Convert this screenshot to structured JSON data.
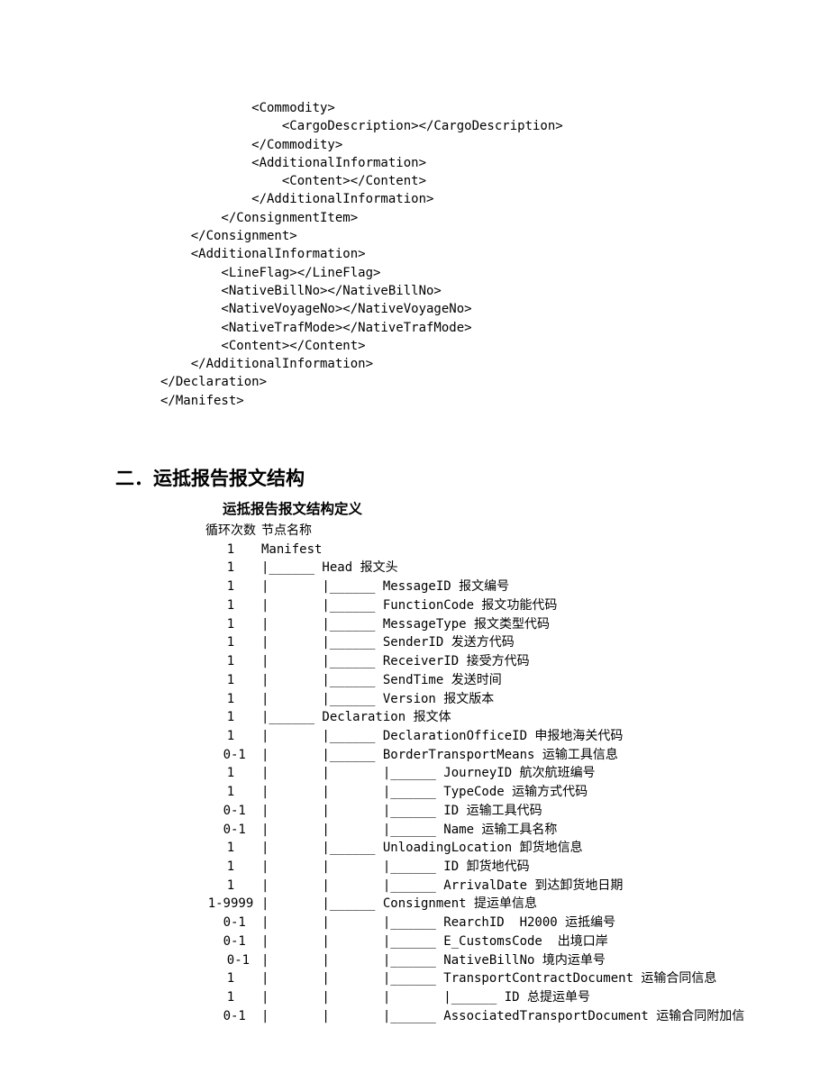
{
  "xml_lines": [
    "            <Commodity>",
    "                <CargoDescription></CargoDescription>",
    "            </Commodity>",
    "            <AdditionalInformation>",
    "                <Content></Content>",
    "            </AdditionalInformation>",
    "        </ConsignmentItem>",
    "    </Consignment>",
    "    <AdditionalInformation>",
    "        <LineFlag></LineFlag>",
    "        <NativeBillNo></NativeBillNo>",
    "        <NativeVoyageNo></NativeVoyageNo>",
    "        <NativeTrafMode></NativeTrafMode>",
    "        <Content></Content>",
    "    </AdditionalInformation>",
    "</Declaration>",
    "</Manifest>"
  ],
  "section_heading": "二．运抵报告报文结构",
  "sub_heading": "运抵报告报文结构定义",
  "tree_header": {
    "count": "循环次数",
    "node": "节点名称"
  },
  "tree_rows": [
    {
      "count": "1",
      "node": "Manifest"
    },
    {
      "count": "1",
      "node": "|______ Head 报文头"
    },
    {
      "count": "1",
      "node": "|       |______ MessageID 报文编号"
    },
    {
      "count": "1",
      "node": "|       |______ FunctionCode 报文功能代码"
    },
    {
      "count": "1",
      "node": "|       |______ MessageType 报文类型代码"
    },
    {
      "count": "1",
      "node": "|       |______ SenderID 发送方代码"
    },
    {
      "count": "1",
      "node": "|       |______ ReceiverID 接受方代码"
    },
    {
      "count": "1",
      "node": "|       |______ SendTime 发送时间"
    },
    {
      "count": "1",
      "node": "|       |______ Version 报文版本"
    },
    {
      "count": "1",
      "node": "|______ Declaration 报文体"
    },
    {
      "count": "1",
      "node": "|       |______ DeclarationOfficeID 申报地海关代码"
    },
    {
      "count": " 0-1",
      "node": "|       |______ BorderTransportMeans 运输工具信息"
    },
    {
      "count": "1",
      "node": "|       |       |______ JourneyID 航次航班编号"
    },
    {
      "count": "1",
      "node": "|       |       |______ TypeCode 运输方式代码"
    },
    {
      "count": " 0-1",
      "node": "|       |       |______ ID 运输工具代码"
    },
    {
      "count": " 0-1",
      "node": "|       |       |______ Name 运输工具名称"
    },
    {
      "count": "1",
      "node": "|       |______ UnloadingLocation 卸货地信息"
    },
    {
      "count": "1",
      "node": "|       |       |______ ID 卸货地代码"
    },
    {
      "count": "1",
      "node": "|       |       |______ ArrivalDate 到达卸货地日期"
    },
    {
      "count": "1-9999",
      "node": "|       |______ Consignment 提运单信息"
    },
    {
      "count": " 0-1",
      "node": "|       |       |______ RearchID  H2000 运抵编号"
    },
    {
      "count": " 0-1",
      "node": "|       |       |______ E_CustomsCode  出境口岸"
    },
    {
      "count": "  0-1",
      "node": "|       |       |______ NativeBillNo 境内运单号"
    },
    {
      "count": "1",
      "node": "|       |       |______ TransportContractDocument 运输合同信息"
    },
    {
      "count": "1",
      "node": "|       |       |       |______ ID 总提运单号"
    },
    {
      "count": " 0-1",
      "node": "|       |       |______ AssociatedTransportDocument 运输合同附加信"
    }
  ]
}
